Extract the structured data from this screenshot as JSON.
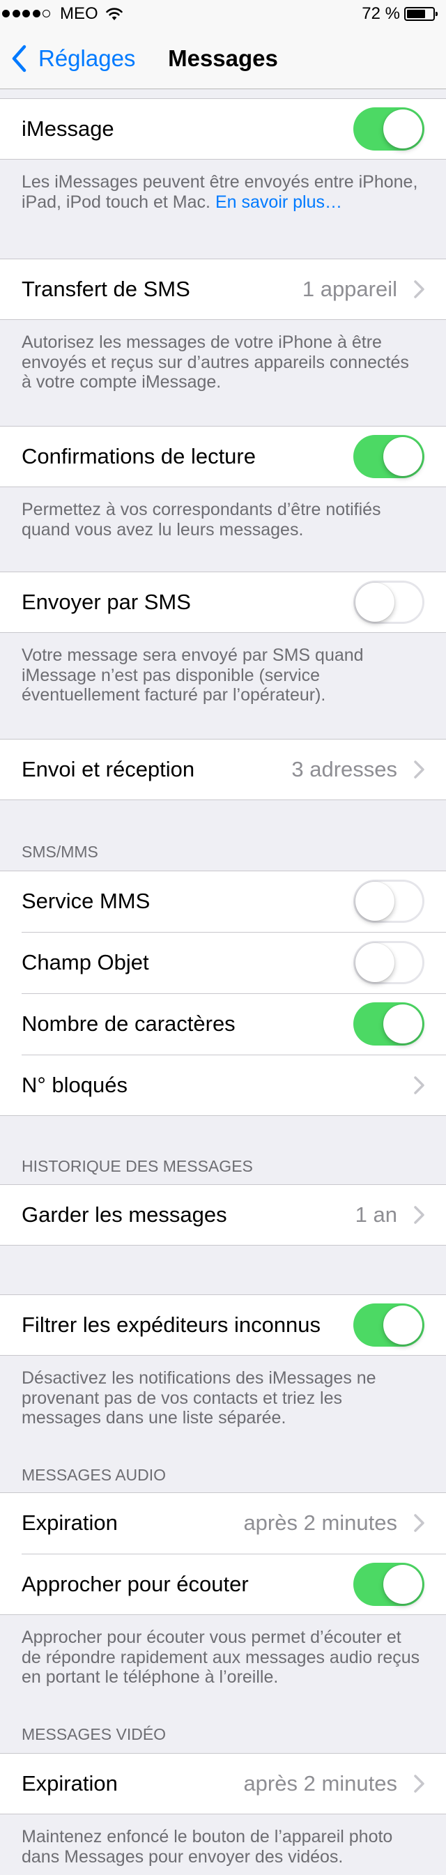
{
  "colors": {
    "accent": "#007aff",
    "switch_on": "#4cd964",
    "background": "#efeff4",
    "secondary_text": "#8e8e93",
    "footer_text": "#6d6d72",
    "separator": "#c8c7cc"
  },
  "status_bar": {
    "signal_bars": 4,
    "signal_max": 5,
    "carrier": "MEO",
    "battery_text": "72 %",
    "battery_level": 0.72
  },
  "nav": {
    "back_label": "Réglages",
    "title": "Messages"
  },
  "imessage": {
    "label": "iMessage",
    "on": true,
    "footer_line1": "Les iMessages peuvent être envoyés entre iPhone,",
    "footer_line2": "iPad, iPod touch et Mac.",
    "footer_link": "En savoir plus…"
  },
  "sms_forwarding": {
    "label": "Transfert de SMS",
    "value": "1 appareil",
    "footer": [
      "Autorisez les messages de votre iPhone à être",
      "envoyés et reçus sur d’autres appareils connectés",
      "à votre compte iMessage."
    ]
  },
  "read_receipts": {
    "label": "Confirmations de lecture",
    "on": true,
    "footer": [
      "Permettez à vos correspondants d’être notifiés",
      "quand vous avez lu leurs messages."
    ]
  },
  "send_as_sms": {
    "label": "Envoyer par SMS",
    "on": false,
    "footer": [
      "Votre message sera envoyé par SMS quand",
      "iMessage n’est pas disponible (service",
      "éventuellement facturé par l’opérateur)."
    ]
  },
  "send_receive": {
    "label": "Envoi et réception",
    "value": "3 adresses"
  },
  "sms_mms": {
    "header": "SMS/MMS",
    "rows": [
      {
        "label": "Service MMS",
        "on": false
      },
      {
        "label": "Champ Objet",
        "on": false
      },
      {
        "label": "Nombre de caractères",
        "on": true
      },
      {
        "label": "N° bloqués"
      }
    ]
  },
  "history": {
    "header": "HISTORIQUE DES MESSAGES",
    "keep_messages": {
      "label": "Garder les messages",
      "value": "1 an"
    }
  },
  "filter_unknown": {
    "label": "Filtrer les expéditeurs inconnus",
    "on": true,
    "footer": [
      "Désactivez les notifications des iMessages ne",
      "provenant pas de vos contacts et triez les",
      "messages dans une liste séparée."
    ]
  },
  "audio_messages": {
    "header": "MESSAGES AUDIO",
    "expiration": {
      "label": "Expiration",
      "value": "après 2 minutes"
    },
    "raise_to_listen": {
      "label": "Approcher pour écouter",
      "on": true
    },
    "footer": [
      "Approcher pour écouter vous permet d’écouter et",
      "de répondre rapidement aux messages audio reçus",
      "en portant le téléphone à l’oreille."
    ]
  },
  "video_messages": {
    "header": "MESSAGES VIDÉO",
    "expiration": {
      "label": "Expiration",
      "value": "après 2 minutes"
    },
    "footer": [
      "Maintenez enfoncé le bouton de l’appareil photo",
      "dans Messages pour envoyer des vidéos."
    ]
  }
}
